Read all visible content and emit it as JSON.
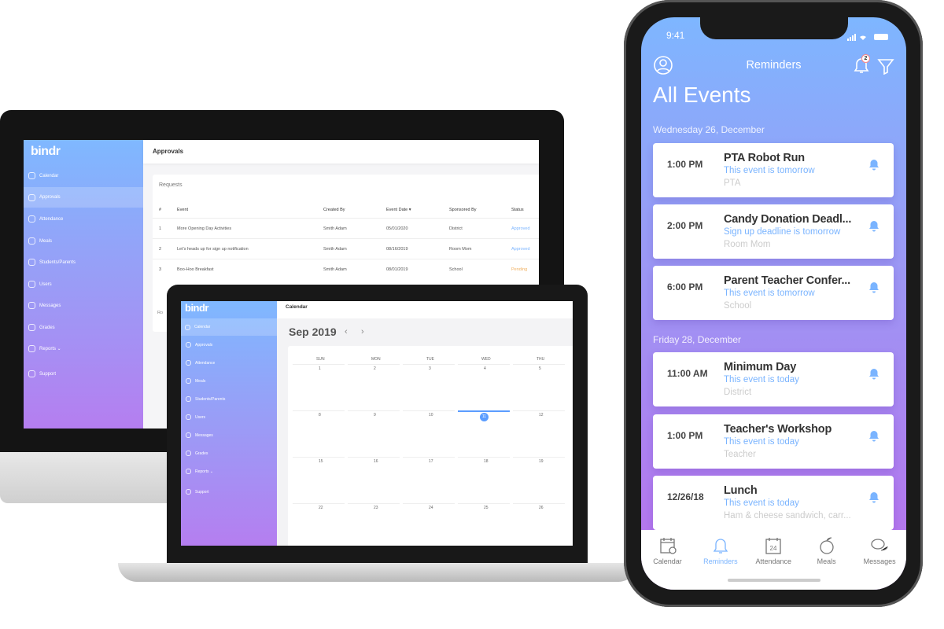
{
  "brand": "bindr",
  "desktop": {
    "header": "Approvals",
    "card_title": "Requests",
    "sidebar": [
      {
        "label": "Calendar",
        "icon": "calendar-icon"
      },
      {
        "label": "Approvals",
        "icon": "check-circle-icon",
        "active": true
      },
      {
        "label": "Attendance",
        "icon": "attendance-icon"
      },
      {
        "label": "Meals",
        "icon": "apple-icon"
      },
      {
        "label": "Students/Parents",
        "icon": "users-icon"
      },
      {
        "label": "Users",
        "icon": "user-icon"
      },
      {
        "label": "Messages",
        "icon": "chat-icon"
      },
      {
        "label": "Grades",
        "icon": "grades-icon"
      },
      {
        "label": "Reports ⌄",
        "icon": "chart-icon"
      },
      {
        "label": "Support",
        "icon": "support-icon"
      }
    ],
    "columns": [
      "#",
      "Event",
      "Created By",
      "Event Date ▾",
      "Sponsored By",
      "Status"
    ],
    "rows": [
      [
        "1",
        "More Opening Day Activities",
        "Smith Adam",
        "05/01/2020",
        "District",
        "Approved"
      ],
      [
        "2",
        "Let's heads up for sign up notification",
        "Smith Adam",
        "08/16/2019",
        "Room Mom",
        "Approved"
      ],
      [
        "3",
        "Boo-Hoo Breakfast",
        "Smith Adam",
        "08/01/2019",
        "School",
        "Pending"
      ]
    ],
    "footer_partial": "Ro"
  },
  "laptop": {
    "header": "Calendar",
    "month": "Sep 2019",
    "prev": "‹",
    "next": "›",
    "sidebar": [
      "Calendar",
      "Approvals",
      "Attendance",
      "Meals",
      "Students/Parents",
      "Users",
      "Messages",
      "Grades",
      "Reports ⌄",
      "Support"
    ],
    "weekdays": [
      "SUN",
      "MON",
      "TUE",
      "WED",
      "THU"
    ],
    "weeks": [
      [
        "1",
        "2",
        "3",
        "4",
        "5"
      ],
      [
        "8",
        "9",
        "10",
        "11",
        "12"
      ],
      [
        "15",
        "16",
        "17",
        "18",
        "19"
      ],
      [
        "22",
        "23",
        "24",
        "25",
        "26"
      ]
    ],
    "today": "11",
    "accent": "#5b9dff"
  },
  "phone": {
    "status_time": "9:41",
    "title": "Reminders",
    "notification_count": "2",
    "heading": "All Events",
    "sections": [
      {
        "label": "Wednesday 26, December",
        "events": [
          {
            "time": "1:00 PM",
            "title": "PTA Robot Run",
            "sub": "This event is tomorrow",
            "meta": "PTA"
          },
          {
            "time": "2:00 PM",
            "title": "Candy Donation Deadl...",
            "sub": "Sign up deadline is tomorrow",
            "meta": "Room Mom"
          },
          {
            "time": "6:00 PM",
            "title": "Parent Teacher Confer...",
            "sub": "This event is tomorrow",
            "meta": "School"
          }
        ]
      },
      {
        "label": "Friday 28, December",
        "events": [
          {
            "time": "11:00 AM",
            "title": "Minimum Day",
            "sub": "This event is today",
            "meta": "District"
          },
          {
            "time": "1:00 PM",
            "title": "Teacher's Workshop",
            "sub": "This event is today",
            "meta": "Teacher"
          },
          {
            "time": "12/26/18",
            "title": "Lunch",
            "sub": "This event is today",
            "meta": "Ham & cheese sandwich, carr..."
          }
        ]
      }
    ],
    "tabs": [
      {
        "label": "Calendar",
        "icon": "calendar-clock-icon"
      },
      {
        "label": "Reminders",
        "icon": "bell-icon",
        "active": true
      },
      {
        "label": "Attendance",
        "icon": "calendar-24-icon",
        "badge": "24"
      },
      {
        "label": "Meals",
        "icon": "apple-icon"
      },
      {
        "label": "Messages",
        "icon": "chat-bubbles-icon"
      }
    ],
    "colors": {
      "accent": "#7ab4ff",
      "gradient_top": "#7eb6ff",
      "gradient_bottom": "#b477ee"
    }
  }
}
